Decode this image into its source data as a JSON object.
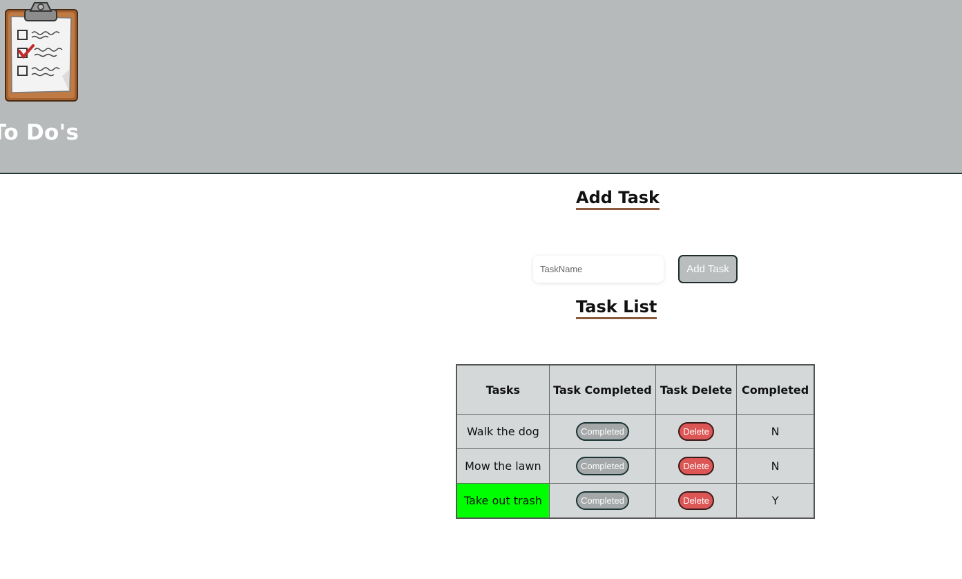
{
  "header": {
    "title": "To Do's",
    "logo_icon": "clipboard-checklist-icon",
    "background": "#b6babb"
  },
  "add_section": {
    "heading": "Add Task",
    "input_placeholder": "TaskName",
    "input_value": "",
    "add_button_label": "Add Task"
  },
  "list_section": {
    "heading": "Task List",
    "columns": [
      "Tasks",
      "Task Completed",
      "Task Delete",
      "Completed"
    ],
    "rows": [
      {
        "task": "Walk the dog",
        "completed_button": "Completed",
        "delete_button": "Delete",
        "completed": "N",
        "highlighted": false
      },
      {
        "task": "Mow the lawn",
        "completed_button": "Completed",
        "delete_button": "Delete",
        "completed": "N",
        "highlighted": false
      },
      {
        "task": "Take out trash",
        "completed_button": "Completed",
        "delete_button": "Delete",
        "completed": "Y",
        "highlighted": true
      }
    ]
  },
  "colors": {
    "accent_underline": "#8b5a3c",
    "table_bg": "#d5d8d9",
    "completed_highlight": "#00ff00",
    "delete_button": "#dd5656",
    "completed_button": "#a4a8a8"
  }
}
